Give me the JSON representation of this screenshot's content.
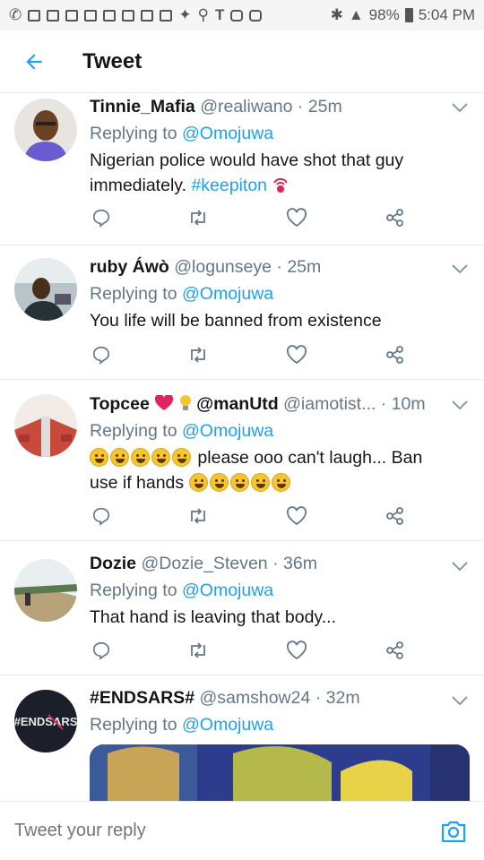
{
  "status_bar": {
    "battery": "98%",
    "time": "5:04 PM"
  },
  "header": {
    "title": "Tweet"
  },
  "tweets": [
    {
      "name": "Tinnie_Mafia",
      "handle": "@realiwano",
      "time": "25m",
      "reply_prefix": "Replying to",
      "reply_to": "@Omojuwa",
      "text": "Nigerian police would have shot that guy immediately.",
      "hashtag": "#keepiton"
    },
    {
      "name": "ruby Áwò",
      "handle": "@logunseye",
      "time": "25m",
      "reply_prefix": "Replying to",
      "reply_to": "@Omojuwa",
      "text": "You life will be banned from existence"
    },
    {
      "name": "Topcee",
      "name_suffix": "@manUtd",
      "handle": "@iamotist...",
      "time": "10m",
      "reply_prefix": "Replying to",
      "reply_to": "@Omojuwa",
      "text_a": "please ooo can't laugh... Ban",
      "text_b": "use if hands"
    },
    {
      "name": "Dozie",
      "handle": "@Dozie_Steven",
      "time": "36m",
      "reply_prefix": "Replying to",
      "reply_to": "@Omojuwa",
      "text": "That hand is leaving that body..."
    },
    {
      "name": "#ENDSARS#",
      "handle": "@samshow24",
      "time": "32m",
      "reply_prefix": "Replying to",
      "reply_to": "@Omojuwa",
      "avatar_text": "#ENDSARS"
    }
  ],
  "reply_bar": {
    "placeholder": "Tweet your reply"
  },
  "colors": {
    "accent": "#1da1f2",
    "muted": "#657786",
    "divider": "#e6ecf0"
  }
}
